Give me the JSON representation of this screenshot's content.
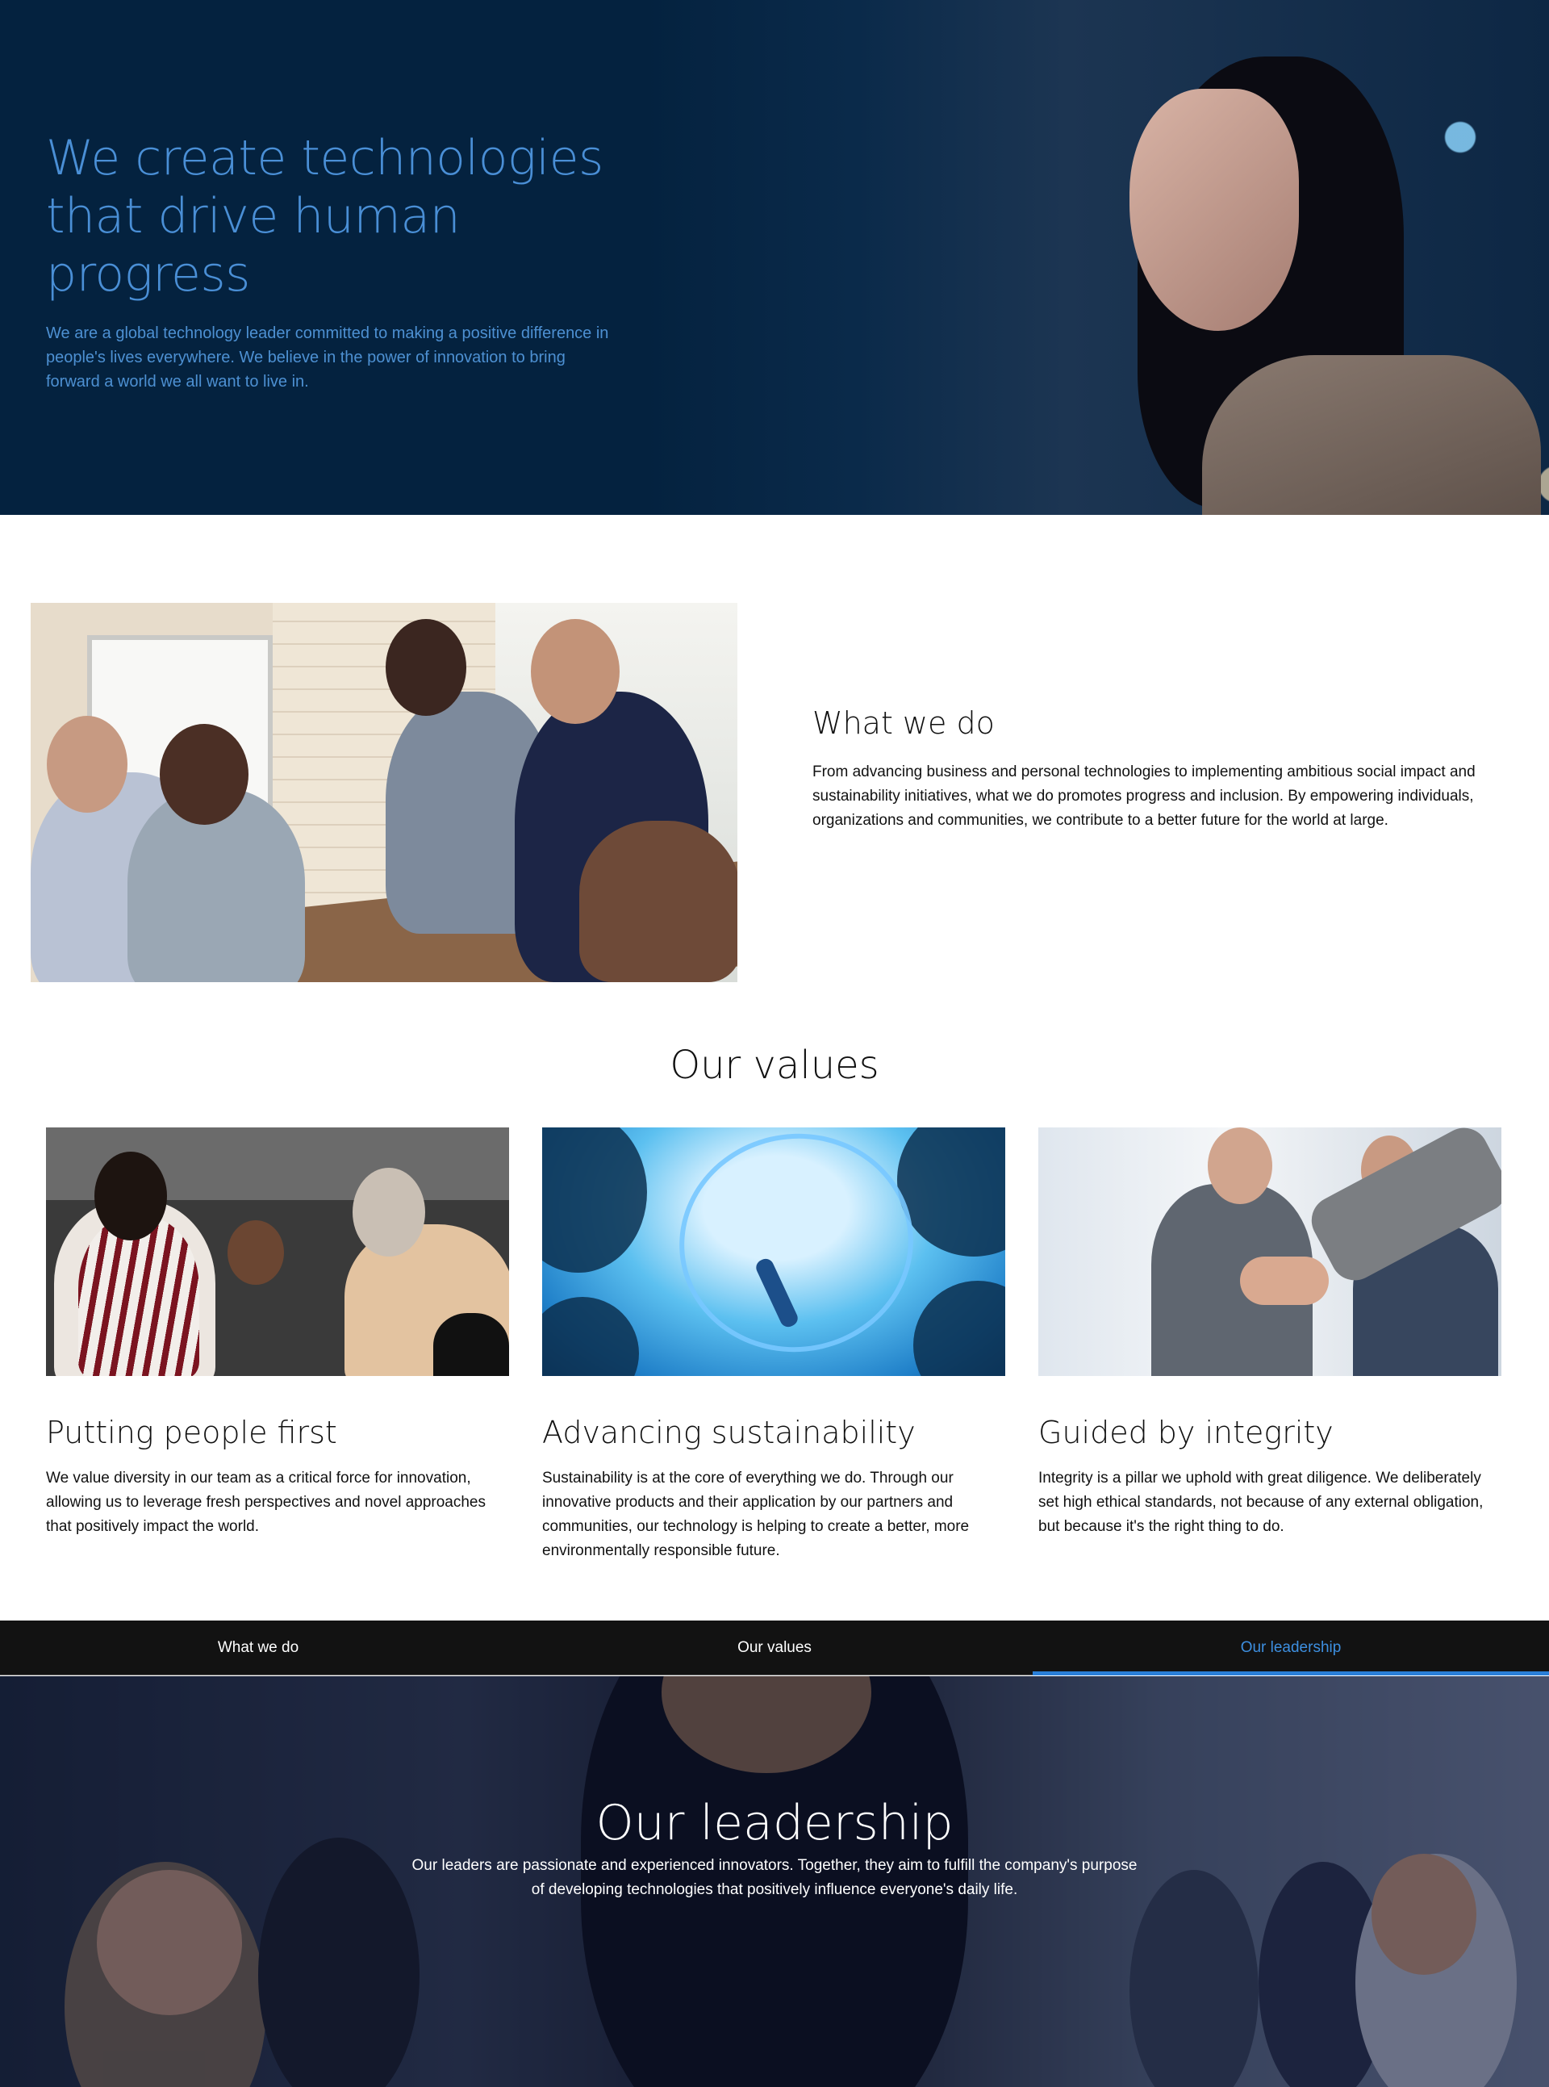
{
  "hero": {
    "title_line1": "We create technologies",
    "title_line2": "that drive human progress",
    "subtitle": "We are a global technology leader committed to making a positive difference in people's lives everywhere. We believe in the power of innovation to bring forward a world we all want to live in."
  },
  "what_we_do": {
    "heading": "What we do",
    "body": "From advancing business and personal technologies to implementing ambitious social impact and sustainability initiatives, what we do promotes progress and inclusion. By empowering individuals, organizations and communities, we contribute to a better future for the world at large."
  },
  "values": {
    "heading": "Our values",
    "cards": [
      {
        "title": "Putting people first",
        "body": "We value diversity in our team as a critical force for innovation, allowing us to leverage fresh perspectives and novel approaches that positively impact the world."
      },
      {
        "title": "Advancing sustainability",
        "body": "Sustainability is at the core of everything we do. Through our innovative products and their application by our partners and communities, our technology is helping to create a better, more environmentally responsible future."
      },
      {
        "title": "Guided by integrity",
        "body": "Integrity is a pillar we uphold with great diligence. We deliberately set high ethical standards, not because of any external obligation, but because it's the right thing to do."
      }
    ]
  },
  "tabs": [
    {
      "label": "What we do",
      "active": false
    },
    {
      "label": "Our values",
      "active": false
    },
    {
      "label": "Our leadership",
      "active": true
    }
  ],
  "leadership": {
    "heading": "Our leadership",
    "body": "Our leaders are passionate and experienced innovators. Together, they aim to fulfill the company's purpose of developing technologies that positively influence everyone's daily life."
  },
  "colors": {
    "hero_bg": "#04223f",
    "hero_text": "#4a8fd6",
    "tab_bar_bg": "#121212",
    "tab_active": "#3d8fe0"
  }
}
